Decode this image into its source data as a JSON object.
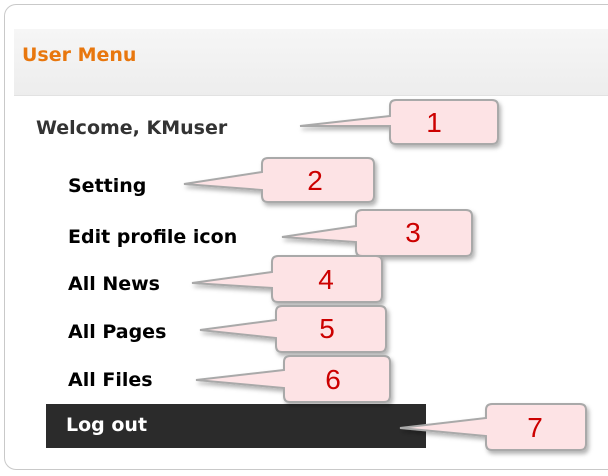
{
  "menu": {
    "title": "User Menu",
    "welcome": "Welcome, KMuser",
    "items": [
      {
        "label": "Setting"
      },
      {
        "label": "Edit profile icon"
      },
      {
        "label": "All News"
      },
      {
        "label": "All Pages"
      },
      {
        "label": "All Files"
      }
    ],
    "logout_label": "Log out"
  },
  "callouts": [
    "1",
    "2",
    "3",
    "4",
    "5",
    "6",
    "7"
  ],
  "colors": {
    "title": "#e8770e",
    "callout_fill": "#fde3e5",
    "callout_border": "#a9a9a9",
    "callout_text": "#cc0000",
    "logout_bg": "#2b2b2b"
  }
}
